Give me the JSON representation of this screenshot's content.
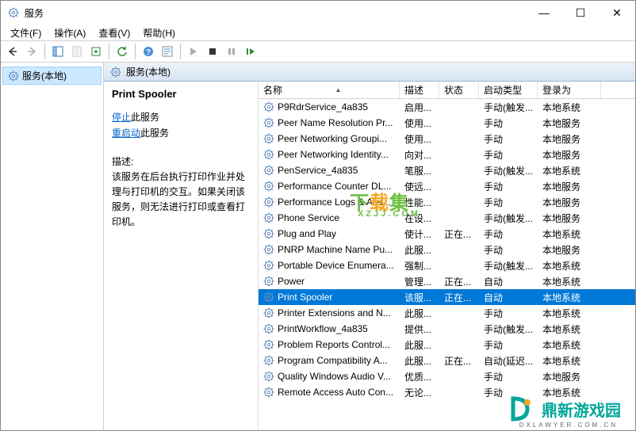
{
  "window": {
    "title": "服务",
    "win_min": "—",
    "win_max": "☐",
    "win_close": "✕"
  },
  "menubar": {
    "file": "文件(F)",
    "action": "操作(A)",
    "view": "查看(V)",
    "help": "帮助(H)"
  },
  "tree": {
    "root_label": "服务(本地)"
  },
  "right_header": {
    "label": "服务(本地)"
  },
  "detail": {
    "title": "Print Spooler",
    "stop_link": "停止",
    "stop_suffix": "此服务",
    "restart_link": "重启动",
    "restart_suffix": "此服务",
    "desc_label": "描述:",
    "desc_text": "该服务在后台执行打印作业并处理与打印机的交互。如果关闭该服务，则无法进行打印或查看打印机。"
  },
  "columns": {
    "name": "名称",
    "desc": "描述",
    "status": "状态",
    "startup": "启动类型",
    "logon": "登录为"
  },
  "services": [
    {
      "name": "P9RdrService_4a835",
      "desc": "启用...",
      "status": "",
      "startup": "手动(触发...",
      "logon": "本地系统"
    },
    {
      "name": "Peer Name Resolution Pr...",
      "desc": "使用...",
      "status": "",
      "startup": "手动",
      "logon": "本地服务"
    },
    {
      "name": "Peer Networking Groupi...",
      "desc": "使用...",
      "status": "",
      "startup": "手动",
      "logon": "本地服务"
    },
    {
      "name": "Peer Networking Identity...",
      "desc": "向对...",
      "status": "",
      "startup": "手动",
      "logon": "本地服务"
    },
    {
      "name": "PenService_4a835",
      "desc": "笔服...",
      "status": "",
      "startup": "手动(触发...",
      "logon": "本地系统"
    },
    {
      "name": "Performance Counter DL...",
      "desc": "使远...",
      "status": "",
      "startup": "手动",
      "logon": "本地服务"
    },
    {
      "name": "Performance Logs & Aler...",
      "desc": "性能...",
      "status": "",
      "startup": "手动",
      "logon": "本地服务"
    },
    {
      "name": "Phone Service",
      "desc": "在设...",
      "status": "",
      "startup": "手动(触发...",
      "logon": "本地服务"
    },
    {
      "name": "Plug and Play",
      "desc": "使计...",
      "status": "正在...",
      "startup": "手动",
      "logon": "本地系统"
    },
    {
      "name": "PNRP Machine Name Pu...",
      "desc": "此服...",
      "status": "",
      "startup": "手动",
      "logon": "本地服务"
    },
    {
      "name": "Portable Device Enumera...",
      "desc": "强制...",
      "status": "",
      "startup": "手动(触发...",
      "logon": "本地系统"
    },
    {
      "name": "Power",
      "desc": "管理...",
      "status": "正在...",
      "startup": "自动",
      "logon": "本地系统"
    },
    {
      "name": "Print Spooler",
      "desc": "该服...",
      "status": "正在...",
      "startup": "自动",
      "logon": "本地系统",
      "selected": true
    },
    {
      "name": "Printer Extensions and N...",
      "desc": "此服...",
      "status": "",
      "startup": "手动",
      "logon": "本地系统"
    },
    {
      "name": "PrintWorkflow_4a835",
      "desc": "提供...",
      "status": "",
      "startup": "手动(触发...",
      "logon": "本地系统"
    },
    {
      "name": "Problem Reports Control...",
      "desc": "此服...",
      "status": "",
      "startup": "手动",
      "logon": "本地系统"
    },
    {
      "name": "Program Compatibility A...",
      "desc": "此服...",
      "status": "正在...",
      "startup": "自动(延迟...",
      "logon": "本地系统"
    },
    {
      "name": "Quality Windows Audio V...",
      "desc": "优质...",
      "status": "",
      "startup": "手动",
      "logon": "本地服务"
    },
    {
      "name": "Remote Access Auto Con...",
      "desc": "无论...",
      "status": "",
      "startup": "手动",
      "logon": "本地系统"
    }
  ],
  "watermark1": {
    "text": "下载集",
    "sub": "XZJJ.COM"
  },
  "watermark2": {
    "text": "鼎新游戏园",
    "sub": "DXLAWYER.COM.CN"
  }
}
